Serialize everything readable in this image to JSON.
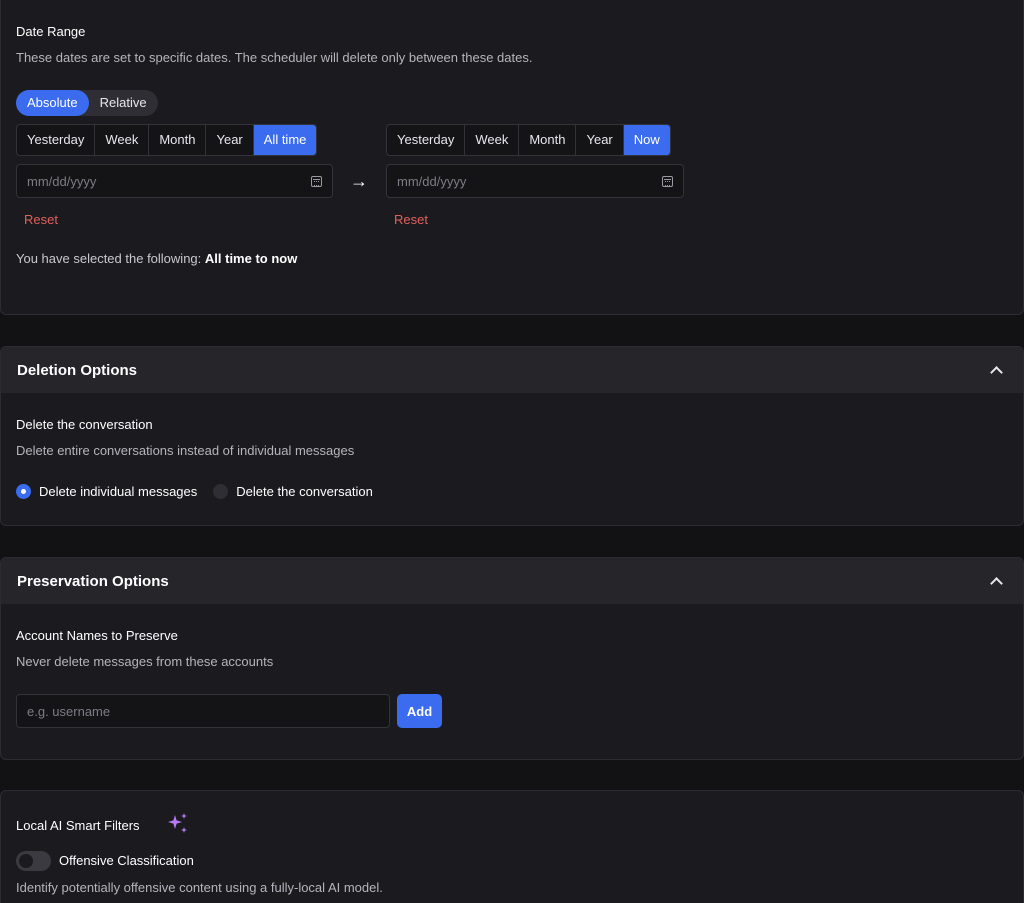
{
  "date_range": {
    "title": "Date Range",
    "description": "These dates are set to specific dates. The scheduler will delete only between these dates.",
    "mode_options": [
      "Absolute",
      "Relative"
    ],
    "mode_selected": "Absolute",
    "start": {
      "presets": [
        "Yesterday",
        "Week",
        "Month",
        "Year",
        "All time"
      ],
      "selected": "All time",
      "placeholder": "mm/dd/yyyy",
      "reset_label": "Reset"
    },
    "end": {
      "presets": [
        "Yesterday",
        "Week",
        "Month",
        "Year",
        "Now"
      ],
      "selected": "Now",
      "placeholder": "mm/dd/yyyy",
      "reset_label": "Reset"
    },
    "arrow": "→",
    "summary_prefix": "You have selected the following:",
    "summary_value": "All time to now"
  },
  "deletion_options": {
    "header": "Deletion Options",
    "title": "Delete the conversation",
    "description": "Delete entire conversations instead of individual messages",
    "radios": [
      {
        "label": "Delete individual messages",
        "checked": true
      },
      {
        "label": "Delete the conversation",
        "checked": false
      }
    ]
  },
  "preservation_options": {
    "header": "Preservation Options",
    "title": "Account Names to Preserve",
    "description": "Never delete messages from these accounts",
    "input_placeholder": "e.g. username",
    "add_label": "Add"
  },
  "ai_filters": {
    "title": "Local AI Smart Filters",
    "sparkle_icon": "sparkles-icon",
    "toggle_label": "Offensive Classification",
    "toggle_on": false,
    "description": "Identify potentially offensive content using a fully-local AI model."
  },
  "colors": {
    "accent": "#3b6cf0",
    "danger": "#e0605c",
    "sparkle": "#b77cf5"
  }
}
